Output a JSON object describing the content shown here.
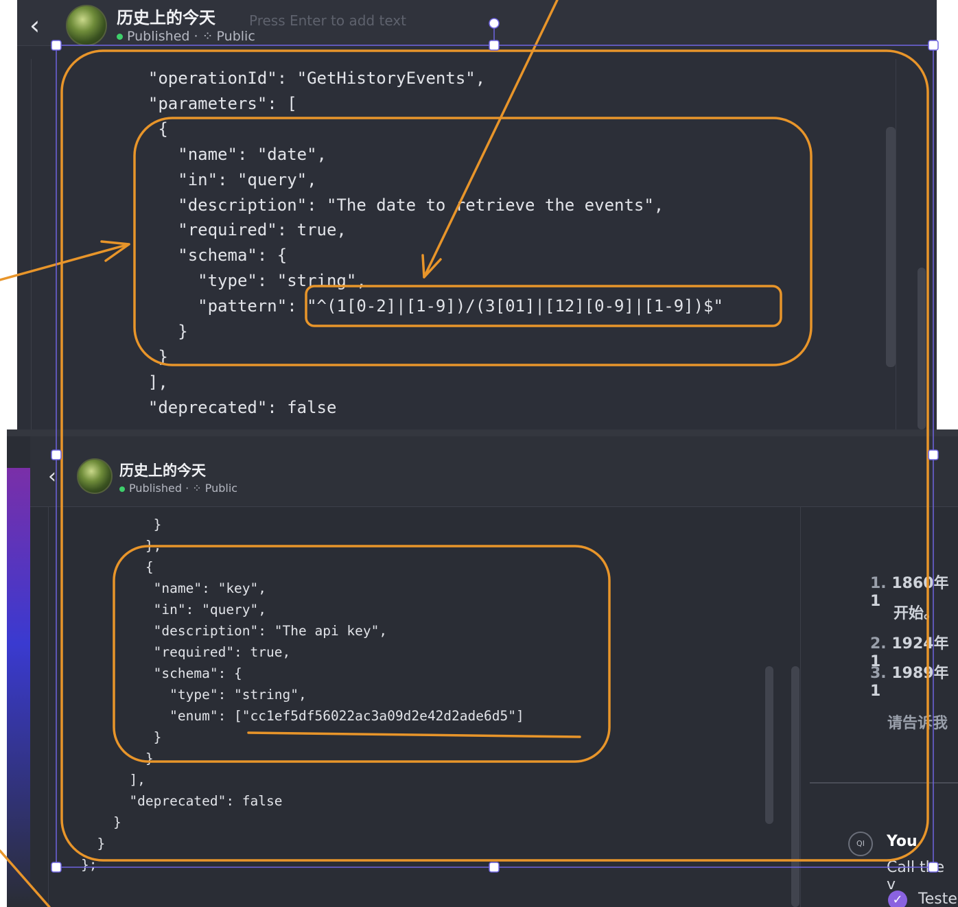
{
  "app": {
    "title": "历史上的今天",
    "status": "Published",
    "visibility": "Public",
    "input_hint": "Press Enter to add text"
  },
  "icons": {
    "back": "chevron-left-icon",
    "visibility": "grid-icon",
    "status_dot_color": "#3ecf6b",
    "annotation_color": "#e8952a",
    "selection_color": "#6e64e0"
  },
  "top_code": [
    "  \"operationId\": \"GetHistoryEvents\",",
    "  \"parameters\": [",
    "   {",
    "     \"name\": \"date\",",
    "     \"in\": \"query\",",
    "     \"description\": \"The date to retrieve the events\",",
    "     \"required\": true,",
    "     \"schema\": {",
    "       \"type\": \"string\",",
    "       \"pattern\": \"^(1[0-2]|[1-9])/(3[01]|[12][0-9]|[1-9])$\"",
    "     }",
    "   }",
    "  ],",
    "  \"deprecated\": false"
  ],
  "bottom_code": [
    "         }",
    "        },",
    "        {",
    "         \"name\": \"key\",",
    "         \"in\": \"query\",",
    "         \"description\": \"The api key\",",
    "         \"required\": true,",
    "         \"schema\": {",
    "           \"type\": \"string\",",
    "           \"enum\": [\"cc1ef5df56022ac3a09d2e42d2ade6d5\"]",
    "         }",
    "        }",
    "      ],",
    "      \"deprecated\": false",
    "    }",
    "  }",
    "};"
  ],
  "chat": {
    "items": [
      {
        "num": "1.",
        "text": "1860年1"
      },
      {
        "num": "",
        "text": "开始。"
      },
      {
        "num": "2.",
        "text": "1924年1"
      },
      {
        "num": "3.",
        "text": "1989年1"
      }
    ],
    "prompt": "请告诉我",
    "user_initials": "QI",
    "user_name": "You",
    "call_text": "Call the v",
    "tested_label": "Teste"
  }
}
